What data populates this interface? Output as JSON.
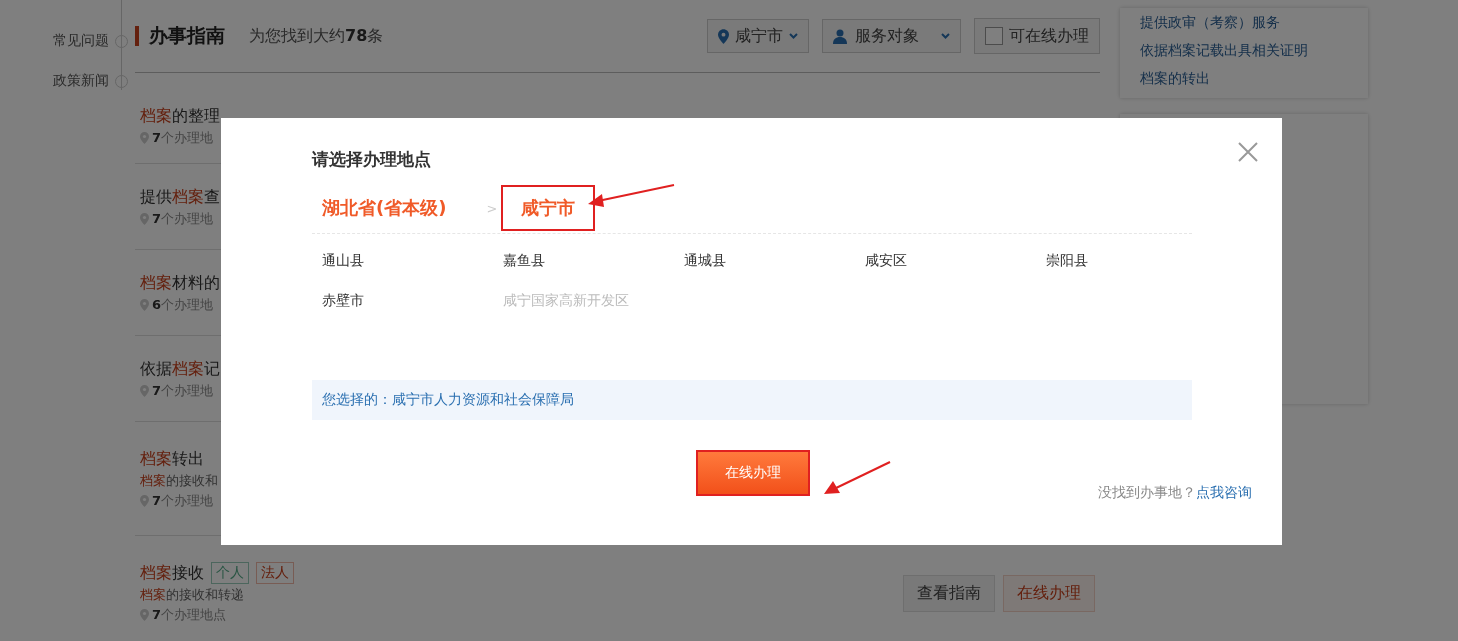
{
  "sidebar": {
    "items": [
      {
        "label": "常见问题"
      },
      {
        "label": "政策新闻"
      }
    ]
  },
  "header": {
    "title": "办事指南",
    "result": "为您找到大约**78**条"
  },
  "filters": {
    "location": "咸宁市",
    "audience": "服务对象",
    "online_only": {
      "label": "可在线办理",
      "checked": false
    }
  },
  "results": [
    {
      "title": "**档案**的整理",
      "sites": "**7**个办理地"
    },
    {
      "title": "提供**档案**查",
      "sites": "**7**个办理地"
    },
    {
      "title": "**档案**材料的",
      "sites": "**6**个办理地"
    },
    {
      "title": "依据**档案**记",
      "sites": "**7**个办理地"
    },
    {
      "title": "**档案**转出",
      "desc": "**档案**的接收和",
      "sites": "**7**个办理地"
    },
    {
      "title": "**档案**接收",
      "tags": [
        {
          "label": "个人",
          "kind": "person"
        },
        {
          "label": "法人",
          "kind": "corp"
        }
      ],
      "desc": "**档案**的接收和转递",
      "sites": "**7**个办理地点",
      "buttons": [
        "查看指南",
        "在线办理"
      ]
    }
  ],
  "related": {
    "items": [
      "提供政审（考察）服务",
      "依据档案记载出具相关证明",
      "档案的转出"
    ]
  },
  "dialog": {
    "title": "请选择办理地点",
    "breadcrumb": [
      {
        "label": "湖北省(省本级)",
        "highlighted": false
      },
      {
        "label": "咸宁市",
        "highlighted": true
      }
    ],
    "separator": ">",
    "regions": [
      {
        "label": "通山县",
        "disabled": false
      },
      {
        "label": "嘉鱼县",
        "disabled": false
      },
      {
        "label": "通城县",
        "disabled": false
      },
      {
        "label": "咸安区",
        "disabled": false
      },
      {
        "label": "崇阳县",
        "disabled": false
      },
      {
        "label": "赤壁市",
        "disabled": false
      },
      {
        "label": "咸宁国家高新开发区",
        "disabled": true
      }
    ],
    "selection": {
      "label": "您选择的：",
      "value": "咸宁市人力资源和社会保障局"
    },
    "submit": {
      "label": "在线办理",
      "highlighted": true
    },
    "help": {
      "text": "没找到办事地？",
      "link": "点我咨询"
    }
  }
}
